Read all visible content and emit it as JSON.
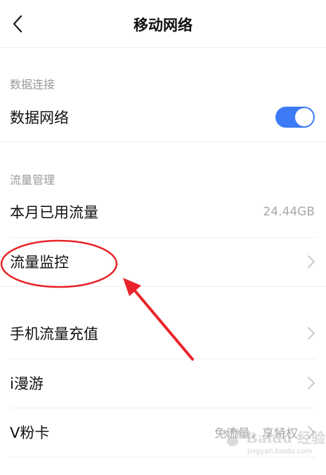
{
  "header": {
    "title": "移动网络"
  },
  "sections": {
    "data_connection": {
      "label": "数据连接",
      "data_network": {
        "label": "数据网络",
        "toggle_on": true
      }
    },
    "traffic_management": {
      "label": "流量管理",
      "monthly_usage": {
        "label": "本月已用流量",
        "value": "24.44GB"
      },
      "traffic_monitor": {
        "label": "流量监控"
      }
    }
  },
  "other_items": {
    "recharge": {
      "label": "手机流量充值"
    },
    "roaming": {
      "label": "i漫游"
    },
    "vcard": {
      "label": "V粉卡",
      "value": "免流量，享特权"
    }
  },
  "watermark": {
    "brand": "Baidu 经验",
    "url": "jingyan.baidu.com"
  },
  "colors": {
    "accent": "#3d7bf6",
    "annotation": "#e8242a"
  }
}
